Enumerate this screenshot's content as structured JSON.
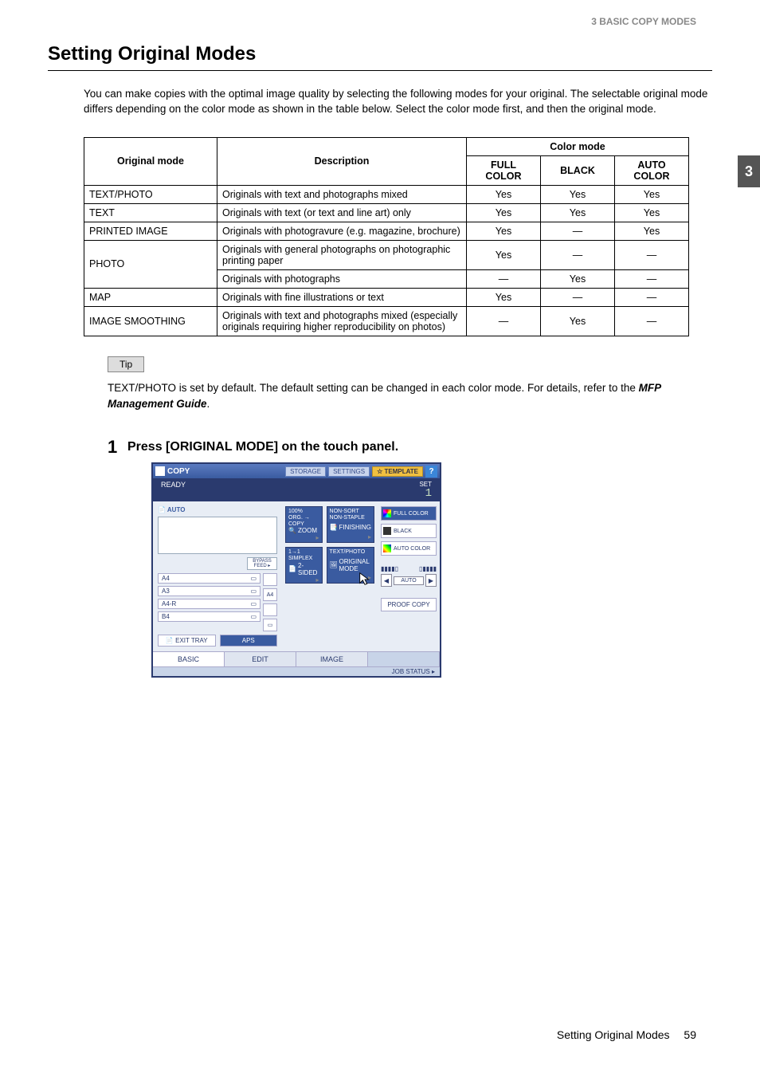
{
  "header": "3 BASIC COPY MODES",
  "side_tab": "3",
  "title": "Setting Original Modes",
  "intro": "You can make copies with the optimal image quality by selecting the following modes for your original. The selectable original mode differs depending on the color mode as shown in the table below. Select the color mode first, and then the original mode.",
  "table": {
    "h1": "Original mode",
    "h2": "Description",
    "h3": "Color mode",
    "h3a": "FULL COLOR",
    "h3b": "BLACK",
    "h3c": "AUTO COLOR",
    "rows": [
      {
        "mode": "TEXT/PHOTO",
        "desc": "Originals with text and photographs mixed",
        "a": "Yes",
        "b": "Yes",
        "c": "Yes"
      },
      {
        "mode": "TEXT",
        "desc": "Originals with text (or text and line art) only",
        "a": "Yes",
        "b": "Yes",
        "c": "Yes"
      },
      {
        "mode": "PRINTED IMAGE",
        "desc": "Originals with photogravure (e.g. magazine, brochure)",
        "a": "Yes",
        "b": "—",
        "c": "Yes"
      }
    ],
    "photo": {
      "mode": "PHOTO",
      "desc1": "Originals with general photographs on photographic printing paper",
      "a1": "Yes",
      "b1": "—",
      "c1": "—",
      "desc2": "Originals with photographs",
      "a2": "—",
      "b2": "Yes",
      "c2": "—"
    },
    "map": {
      "mode": "MAP",
      "desc": "Originals with fine illustrations or text",
      "a": "Yes",
      "b": "—",
      "c": "—"
    },
    "smooth": {
      "mode": "IMAGE SMOOTHING",
      "desc": "Originals with text and photographs mixed (especially originals requiring higher reproducibility on photos)",
      "a": "—",
      "b": "Yes",
      "c": "—"
    }
  },
  "tip_label": "Tip",
  "tip_text_a": "TEXT/PHOTO is set by default. The default setting can be changed in each color mode. For details, refer to the ",
  "tip_text_b": "MFP Management Guide",
  "tip_text_c": ".",
  "step": {
    "num": "1",
    "title": "Press [ORIGINAL MODE] on the touch panel."
  },
  "panel": {
    "copy": "COPY",
    "storage": "STORAGE",
    "settings": "SETTINGS",
    "template": "TEMPLATE",
    "help": "?",
    "ready": "READY",
    "set": "SET",
    "one": "1",
    "auto": "AUTO",
    "bypass": "BYPASS FEED ▸",
    "trays": [
      "A4",
      "A3",
      "A4-R",
      "B4"
    ],
    "a4_side": "A4",
    "exit": "EXIT TRAY",
    "aps": "APS",
    "t100": "100%",
    "torg": "ORG. → COPY",
    "tzoom": "ZOOM",
    "tsort": "NON-SORT NON-STAPLE",
    "tfin": "FINISHING",
    "tsimplex_a": "1→1",
    "tsimplex_b": "SIMPLEX",
    "t2s": "2-SIDED",
    "ttp": "TEXT/PHOTO",
    "tom": "ORIGINAL MODE",
    "full": "FULL COLOR",
    "black": "BLACK",
    "autoc": "AUTO COLOR",
    "autobtn": "AUTO",
    "proof": "PROOF COPY",
    "tab_basic": "BASIC",
    "tab_edit": "EDIT",
    "tab_image": "IMAGE",
    "job": "JOB STATUS ▸"
  },
  "footer": {
    "title": "Setting Original Modes",
    "page": "59"
  }
}
